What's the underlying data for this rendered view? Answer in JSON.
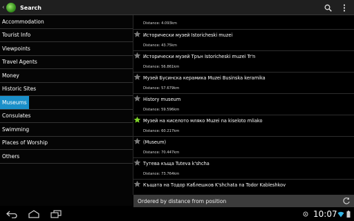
{
  "app": {
    "title": "Search"
  },
  "sidebar": {
    "items": [
      {
        "label": "Accommodation"
      },
      {
        "label": "Tourist Info"
      },
      {
        "label": "Viewpoints"
      },
      {
        "label": "Travel Agents"
      },
      {
        "label": "Money"
      },
      {
        "label": "Historic Sites"
      },
      {
        "label": "Museums",
        "selected": true
      },
      {
        "label": "Consulates"
      },
      {
        "label": "Swimming"
      },
      {
        "label": "Places of Worship"
      },
      {
        "label": "Others"
      }
    ]
  },
  "results": [
    {
      "title": "",
      "distance": "Distance: 4.093km"
    },
    {
      "title": "Исторически музей Istoricheski muzei",
      "distance": "Distance: 43.75km",
      "favorite": false
    },
    {
      "title": "Исторически музей Трън Istoricheski muzei Tr'n",
      "distance": "Distance: 56.861km",
      "favorite": false
    },
    {
      "title": "Музей Бусинска керамика Muzei Businska keramika",
      "distance": "Distance: 57.679km",
      "favorite": false
    },
    {
      "title": "History museum",
      "distance": "Distance: 59.596km",
      "favorite": false
    },
    {
      "title": "Музей на киселото мляко Muzei na kiseloto mliako",
      "distance": "Distance: 60.217km",
      "favorite": true
    },
    {
      "title": "(Museum)",
      "distance": "Distance: 70.447km",
      "favorite": false
    },
    {
      "title": "Тутева къща Tuteva k'shcha",
      "distance": "Distance: 73.764km",
      "favorite": false
    },
    {
      "title": "Къщата на Тодор Каблешков K'shchata na Todor Kableshkov",
      "distance": "",
      "favorite": false
    }
  ],
  "order_bar": {
    "label": "Ordered by distance from position"
  },
  "status": {
    "time": "10:07"
  },
  "icons": {
    "search": "search-icon",
    "overflow": "overflow-menu-icon",
    "star": "star-icon",
    "refresh": "refresh-icon",
    "back": "back-nav-icon",
    "home": "home-nav-icon",
    "recents": "recent-apps-icon",
    "gps": "gps-icon",
    "wifi": "wifi-icon",
    "battery": "battery-icon"
  },
  "colors": {
    "selected": "#1a8fc9",
    "star_on": "#7fd22a",
    "star_off": "#7a7a7a",
    "order_bar": "#3b3b3b"
  }
}
